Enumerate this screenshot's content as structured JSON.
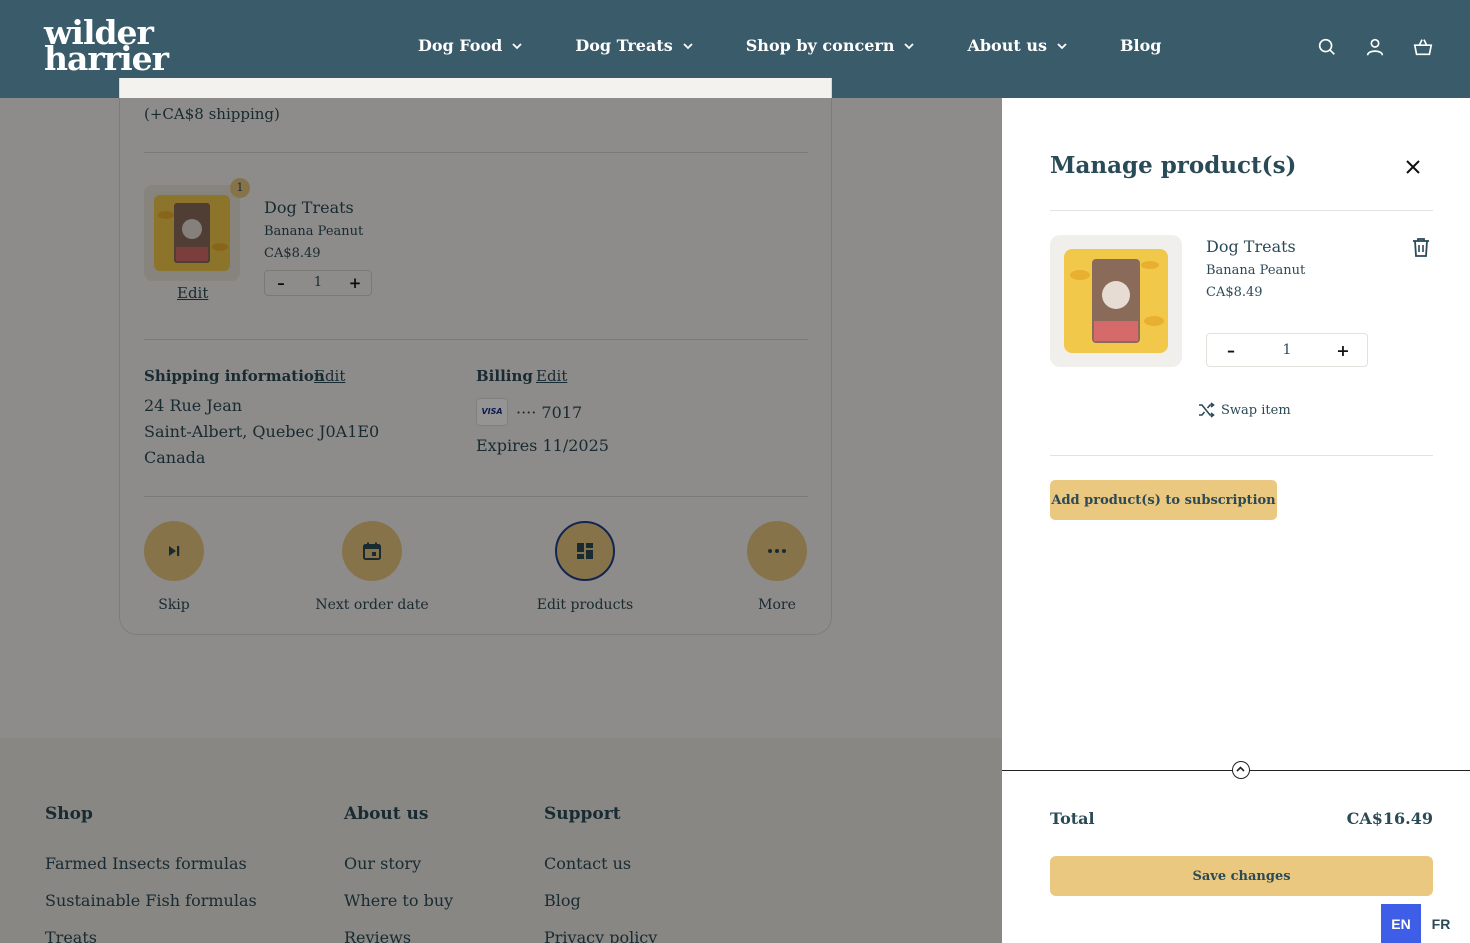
{
  "header": {
    "logo_line1": "wilder",
    "logo_line2": "harrier",
    "nav": [
      {
        "label": "Dog Food",
        "has_dropdown": true
      },
      {
        "label": "Dog Treats",
        "has_dropdown": true
      },
      {
        "label": "Shop by concern",
        "has_dropdown": true
      },
      {
        "label": "About us",
        "has_dropdown": true
      },
      {
        "label": "Blog",
        "has_dropdown": false
      }
    ],
    "icons": [
      "search-icon",
      "account-icon",
      "cart-icon"
    ]
  },
  "order": {
    "shipping_cost": "(+CA$8 shipping)",
    "item": {
      "quantity_badge": "1",
      "title": "Dog Treats",
      "variant": "Banana Peanut",
      "price": "CA$8.49",
      "qty_minus": "–",
      "qty_value": "1",
      "qty_plus": "+",
      "edit_label": "Edit"
    },
    "shipping": {
      "label": "Shipping information",
      "edit_label": "Edit",
      "line1": "24 Rue Jean",
      "line2": "Saint-Albert, Quebec J0A1E0",
      "line3": "Canada"
    },
    "billing": {
      "label": "Billing",
      "edit_label": "Edit",
      "card_brand": "VISA",
      "card_masked": "···· 7017",
      "expires": "Expires 11/2025"
    },
    "actions": [
      {
        "label": "Skip",
        "icon": "skip-icon"
      },
      {
        "label": "Next order date",
        "icon": "calendar-icon"
      },
      {
        "label": "Edit products",
        "icon": "grid-icon",
        "active": true
      },
      {
        "label": "More",
        "icon": "more-icon"
      }
    ]
  },
  "footer": {
    "cols": [
      {
        "title": "Shop",
        "links": [
          "Farmed Insects formulas",
          "Sustainable Fish formulas",
          "Treats"
        ]
      },
      {
        "title": "About us",
        "links": [
          "Our story",
          "Where to buy",
          "Reviews"
        ]
      },
      {
        "title": "Support",
        "links": [
          "Contact us",
          "Blog",
          "Privacy policy"
        ]
      }
    ]
  },
  "drawer": {
    "title": "Manage product(s)",
    "product": {
      "title": "Dog Treats",
      "variant": "Banana Peanut",
      "price": "CA$8.49",
      "qty_minus": "–",
      "qty_value": "1",
      "qty_plus": "+"
    },
    "swap_label": "Swap item",
    "add_label": "Add product(s) to subscription",
    "total_label": "Total",
    "total_value": "CA$16.49",
    "save_label": "Save changes"
  },
  "language": {
    "active": "EN",
    "other": "FR"
  },
  "colors": {
    "header_bg": "#3a5b6a",
    "accent_gold": "#ebc880",
    "text_dark_teal": "#2b4a57",
    "lang_active": "#3e5ee8"
  }
}
